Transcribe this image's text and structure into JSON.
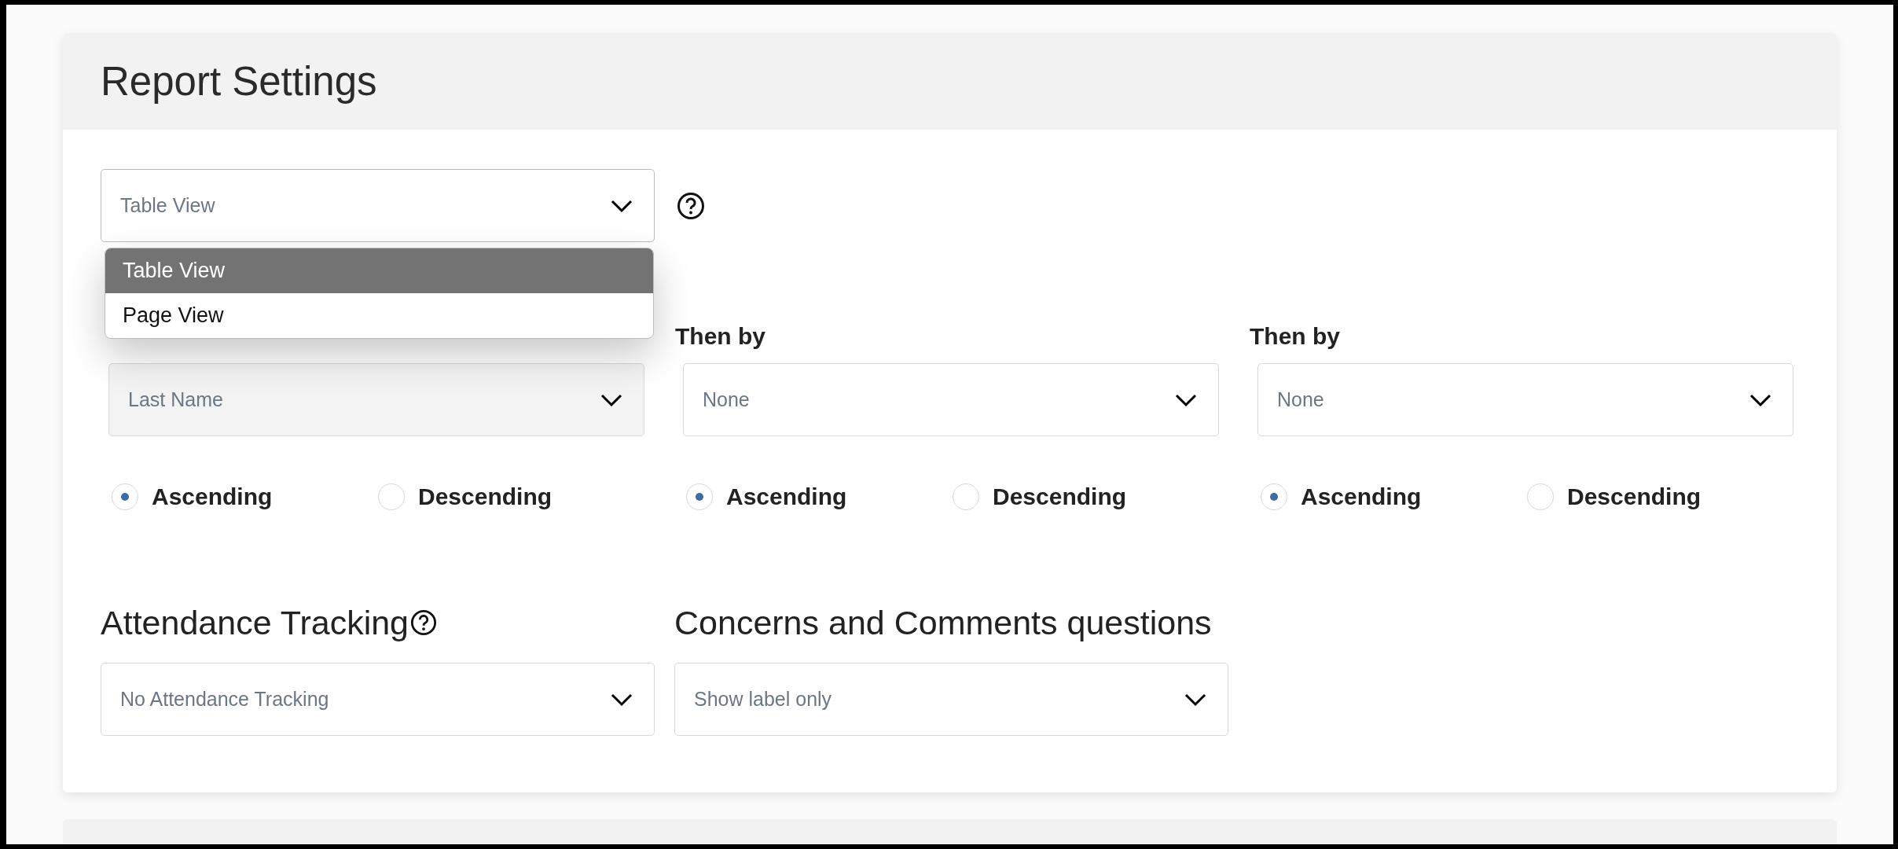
{
  "title": "Report Settings",
  "view_select": {
    "value": "Table View",
    "expanded": true,
    "options": [
      {
        "label": "Table View",
        "selected": true
      },
      {
        "label": "Page View",
        "selected": false
      }
    ]
  },
  "sort_fields": [
    {
      "value": "Last Name",
      "order": [
        {
          "label": "Ascending",
          "selected": true
        },
        {
          "label": "Descending",
          "selected": false
        }
      ]
    },
    {
      "label": "Then by",
      "value": "None",
      "order": [
        {
          "label": "Ascending",
          "selected": true
        },
        {
          "label": "Descending",
          "selected": false
        }
      ]
    },
    {
      "label": "Then by",
      "value": "None",
      "order": [
        {
          "label": "Ascending",
          "selected": true
        },
        {
          "label": "Descending",
          "selected": false
        }
      ]
    }
  ],
  "attendance": {
    "label": "Attendance Tracking",
    "value": "No Attendance Tracking"
  },
  "concerns": {
    "label": "Concerns and Comments questions",
    "value": "Show label only"
  }
}
